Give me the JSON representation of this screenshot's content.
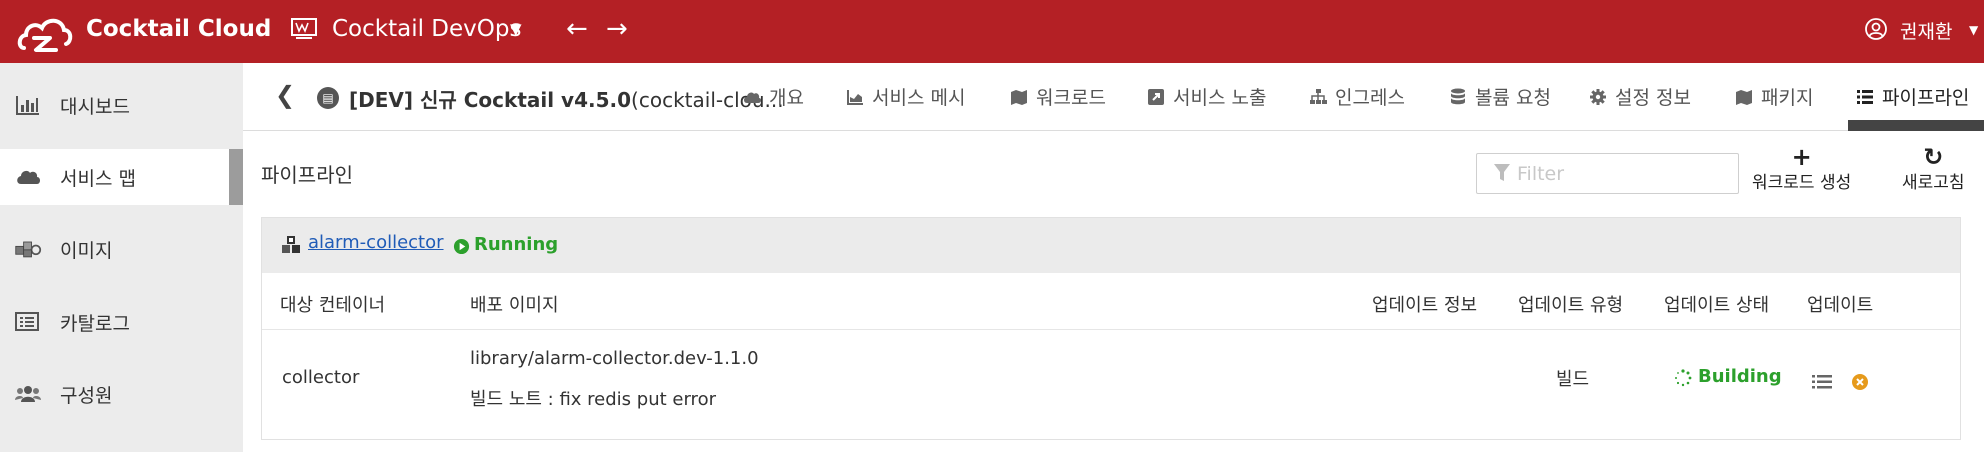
{
  "header": {
    "app_title": "Cocktail Cloud",
    "workspace_name": "Cocktail DevOps",
    "user_name": "권재환",
    "brand_color": "#b42025"
  },
  "sidebar": {
    "items": [
      {
        "label": "대시보드",
        "icon": "bar-chart-icon"
      },
      {
        "label": "서비스 맵",
        "icon": "cloud-icon",
        "active": true
      },
      {
        "label": "이미지",
        "icon": "cubes-icon"
      },
      {
        "label": "카탈로그",
        "icon": "list-alt-icon"
      },
      {
        "label": "구성원",
        "icon": "users-icon"
      }
    ]
  },
  "subnav": {
    "project_prefix": "[DEV] 신규 Cocktail v4.5.0",
    "project_suffix": "(cocktail-clou...",
    "tabs": [
      {
        "label": "개요",
        "icon": "cloud-icon"
      },
      {
        "label": "서비스 메시",
        "icon": "chart-area-icon"
      },
      {
        "label": "워크로드",
        "icon": "map-icon"
      },
      {
        "label": "서비스 노출",
        "icon": "external-link-icon"
      },
      {
        "label": "인그레스",
        "icon": "sitemap-icon"
      },
      {
        "label": "볼륨 요청",
        "icon": "database-icon"
      },
      {
        "label": "설정 정보",
        "icon": "gear-icon"
      },
      {
        "label": "패키지",
        "icon": "map-icon"
      },
      {
        "label": "파이프라인",
        "icon": "list-icon",
        "active": true
      }
    ]
  },
  "main": {
    "page_title": "파이프라인",
    "filter_placeholder": "Filter",
    "actions": {
      "create_workload": "워크로드 생성",
      "refresh": "새로고침"
    },
    "pipeline": {
      "app_name": "alarm-collector",
      "status": "Running",
      "columns": [
        "대상 컨테이너",
        "배포 이미지",
        "업데이트 정보",
        "업데이트 유형",
        "업데이트 상태",
        "업데이트"
      ],
      "rows": [
        {
          "container": "collector",
          "image": "library/alarm-collector.dev-1.1.0",
          "build_note": "빌드 노트 : fix redis put error",
          "update_info": "",
          "update_type": "빌드",
          "update_status": "Building"
        }
      ]
    }
  }
}
